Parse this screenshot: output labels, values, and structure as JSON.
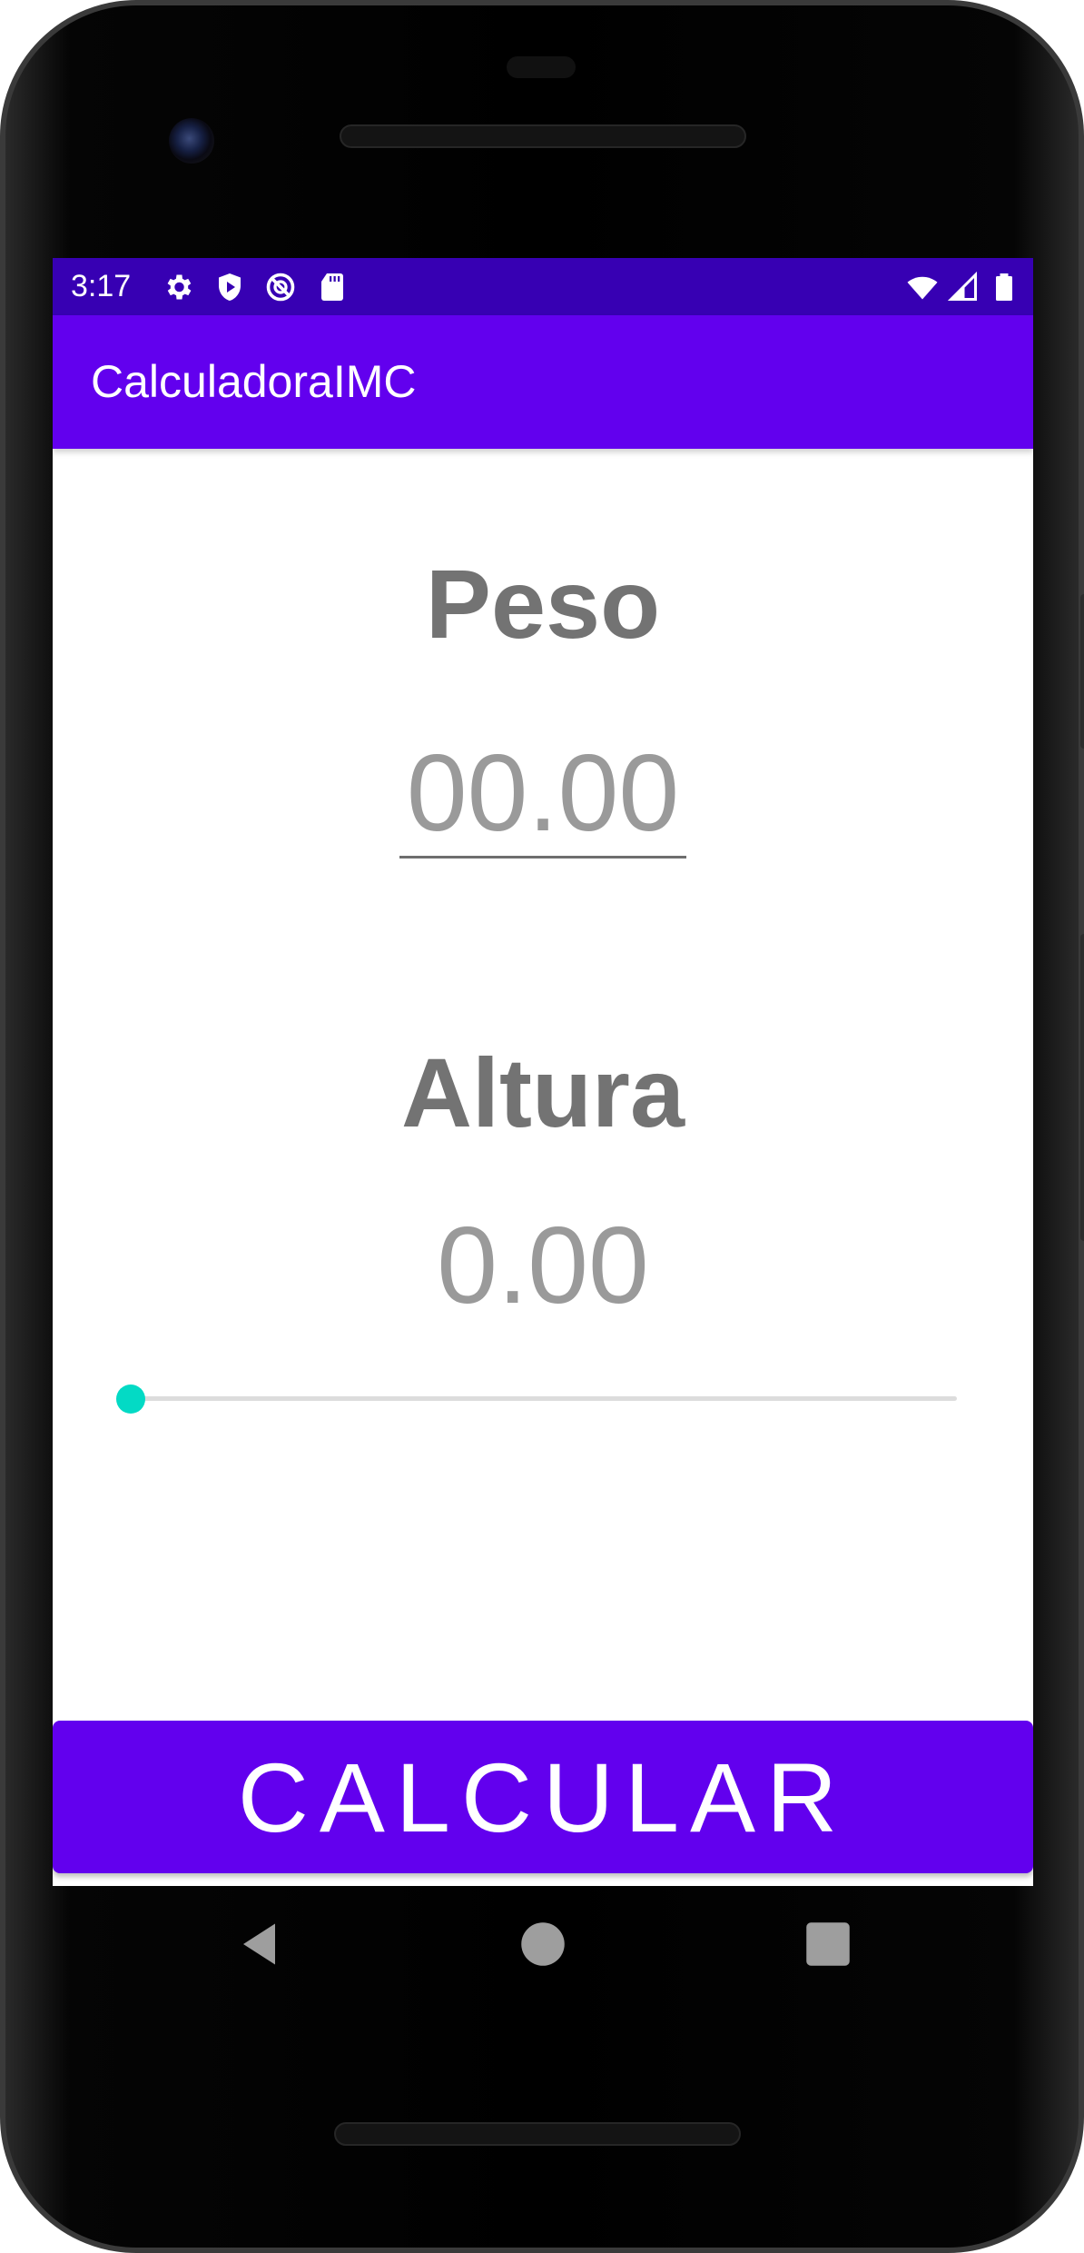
{
  "status_bar": {
    "time": "3:17",
    "left_icons": [
      "gear-icon",
      "shield-play-icon",
      "sync-disabled-icon",
      "sd-card-icon"
    ],
    "right_icons": [
      "wifi-icon",
      "signal-icon",
      "battery-icon"
    ]
  },
  "app_bar": {
    "title": "CalculadoraIMC"
  },
  "main": {
    "weight_label": "Peso",
    "weight_placeholder": "00.00",
    "weight_value": "",
    "height_label": "Altura",
    "height_value": "0.00",
    "height_slider_fraction": 0.0
  },
  "calculate_button": {
    "label": "CALCULAR"
  },
  "nav_bar": {
    "buttons": [
      "back-icon",
      "home-icon",
      "recents-icon"
    ]
  },
  "colors": {
    "status_bar": "#3700b3",
    "primary": "#6200ee",
    "accent": "#03dac5",
    "label_text": "#737373",
    "value_text": "#9a9a9a"
  }
}
